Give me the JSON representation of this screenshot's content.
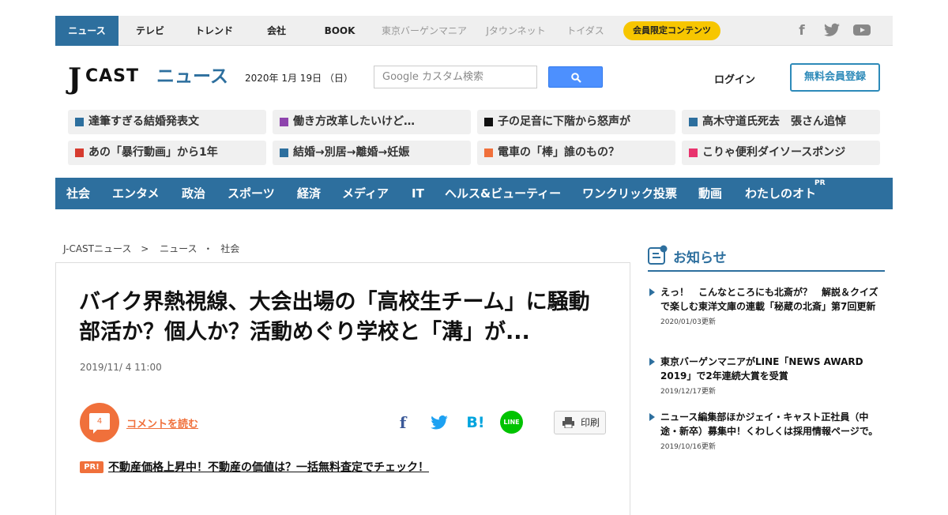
{
  "topnav": {
    "items": [
      "ニュース",
      "テレビ",
      "トレンド",
      "会社",
      "BOOK",
      "東京バーゲンマニア",
      "Jタウンネット",
      "トイダス"
    ],
    "member_badge": "会員限定コンテンツ",
    "social_icons": [
      "facebook-icon",
      "twitter-icon",
      "youtube-icon"
    ]
  },
  "header": {
    "logo_j": "J",
    "logo_cast": "CAST",
    "logo_news": "ニュース",
    "date": "2020年 1月 19日 （日）",
    "search_placeholder": "Google カスタム検索",
    "login": "ログイン",
    "register": "無料会員登録"
  },
  "tags": [
    {
      "label": "達筆すぎる結婚発表文",
      "color": "#2d6f9e"
    },
    {
      "label": "働き方改革したいけど…",
      "color": "#8e44ad"
    },
    {
      "label": "子の足音に下階から怒声が",
      "color": "#111111"
    },
    {
      "label": "高木守道氏死去　張さん追悼",
      "color": "#2d6f9e"
    },
    {
      "label": "あの「暴行動画」から1年",
      "color": "#d63b2f"
    },
    {
      "label": "結婚→別居→離婚→妊娠",
      "color": "#2d6f9e"
    },
    {
      "label": "電車の「棒」誰のもの？",
      "color": "#f0703b"
    },
    {
      "label": "こりゃ便利ダイソースポンジ",
      "color": "#e8336d"
    }
  ],
  "categories": [
    "社会",
    "エンタメ",
    "政治",
    "スポーツ",
    "経済",
    "メディア",
    "IT",
    "ヘルス&ビューティー",
    "ワンクリック投票",
    "動画",
    "わたしのオト"
  ],
  "category_pr": "PR",
  "breadcrumb": [
    "J-CASTニュース",
    ">",
    "ニュース",
    "・",
    "社会"
  ],
  "article": {
    "title": "バイク界熱視線、大会出場の「高校生チーム」に騒動　部活か？個人か？活動めぐり学校と「溝」が...",
    "date": "2019/11/ 4 11:00",
    "comment_count": "4",
    "comment_link": "コメントを読む",
    "share": [
      "f",
      "t",
      "B!",
      "LINE"
    ],
    "print": "印刷",
    "pr_tag": "PR!",
    "pr_link": "不動産価格上昇中！不動産の価値は？一括無料査定でチェック！"
  },
  "sidebar": {
    "title": "お知らせ",
    "notices": [
      {
        "text": "えっ！　こんなところにも北斎が？　解説＆クイズで楽しむ東洋文庫の連載「秘蔵の北斎」第7回更新",
        "date": "2020/01/03更新"
      },
      {
        "text": "東京バーゲンマニアがLINE「NEWS AWARD 2019」で2年連続大賞を受賞",
        "date": "2019/12/17更新"
      },
      {
        "text": "ニュース編集部ほかジェイ・キャスト正社員（中途・新卒）募集中！くわしくは採用情報ページで。",
        "date": "2019/10/16更新"
      }
    ]
  }
}
